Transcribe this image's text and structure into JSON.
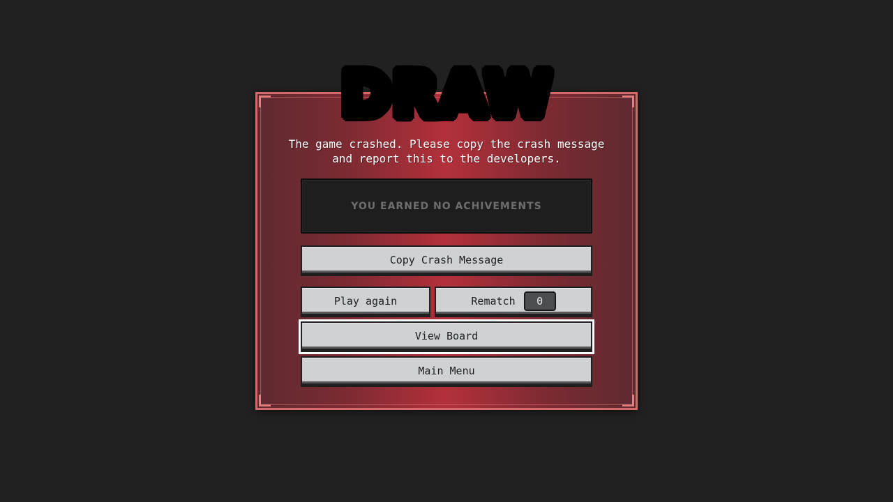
{
  "screen": {
    "title": "DRAW",
    "message": "The game crashed. Please copy the crash message and report this to the developers.",
    "achievements_text": "YOU EARNED NO ACHIVEMENTS"
  },
  "buttons": {
    "copy_label": "Copy Crash Message",
    "play_again_label": "Play again",
    "rematch_label": "Rematch",
    "rematch_count": "0",
    "view_board_label": "View Board",
    "main_menu_label": "Main Menu"
  },
  "colors": {
    "background": "#212121",
    "panel_accent": "#b3303a",
    "panel_border": "#d46a6a",
    "button": "#d0d1d4"
  }
}
